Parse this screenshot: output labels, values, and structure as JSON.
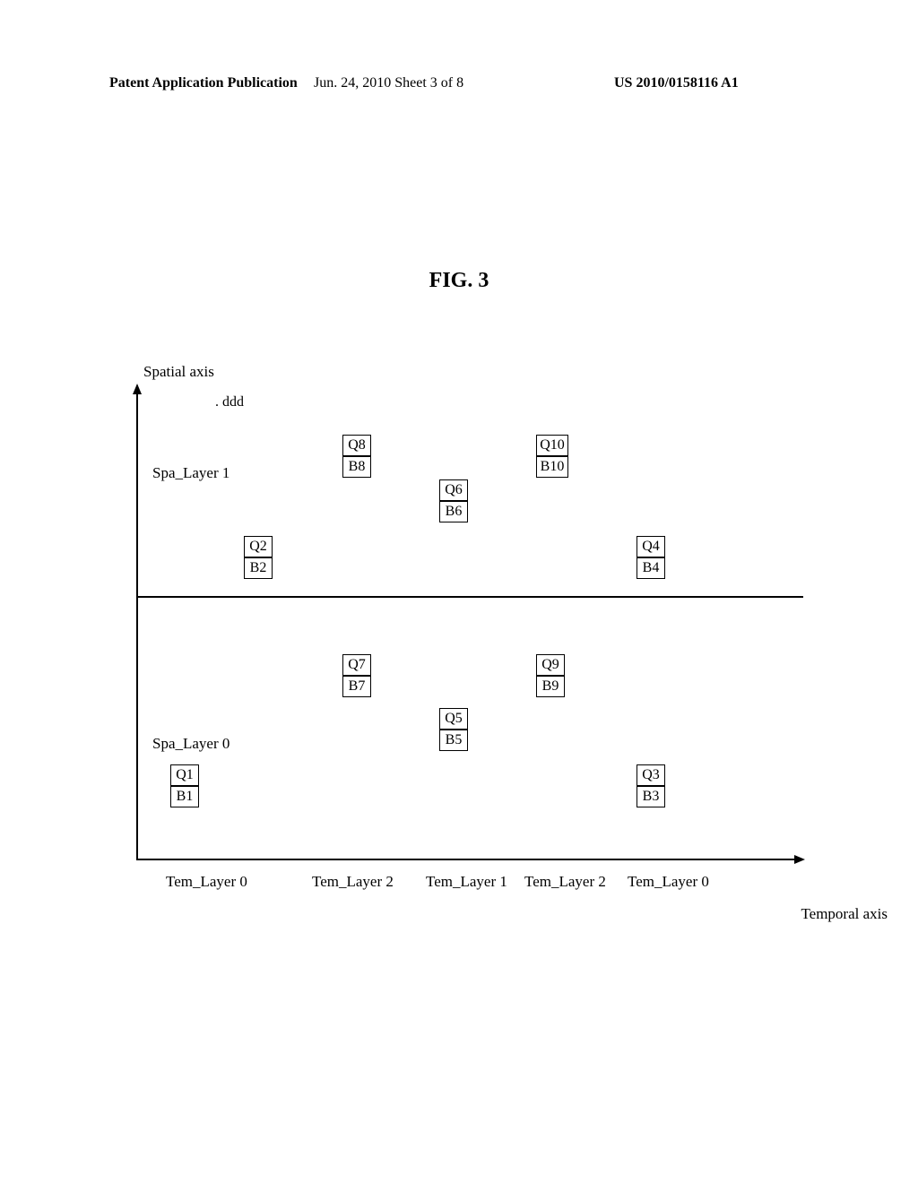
{
  "header": {
    "left": "Patent Application Publication",
    "center": "Jun. 24, 2010  Sheet 3 of 8",
    "right": "US 2010/0158116 A1"
  },
  "figure_title": "FIG. 3",
  "axes": {
    "y_label": "Spatial axis",
    "x_label": "Temporal axis",
    "ddd": ". ddd"
  },
  "spatial_layers": {
    "layer1": "Spa_Layer 1",
    "layer0": "Spa_Layer 0"
  },
  "temporal_layers": {
    "t0a": "Tem_Layer 0",
    "t2a": "Tem_Layer 2",
    "t1": "Tem_Layer 1",
    "t2b": "Tem_Layer 2",
    "t0b": "Tem_Layer 0"
  },
  "boxes": {
    "q1": "Q1",
    "b1": "B1",
    "q2": "Q2",
    "b2": "B2",
    "q3": "Q3",
    "b3": "B3",
    "q4": "Q4",
    "b4": "B4",
    "q5": "Q5",
    "b5": "B5",
    "q6": "Q6",
    "b6": "B6",
    "q7": "Q7",
    "b7": "B7",
    "q8": "Q8",
    "b8": "B8",
    "q9": "Q9",
    "b9": "B9",
    "q10": "Q10",
    "b10": "B10"
  }
}
